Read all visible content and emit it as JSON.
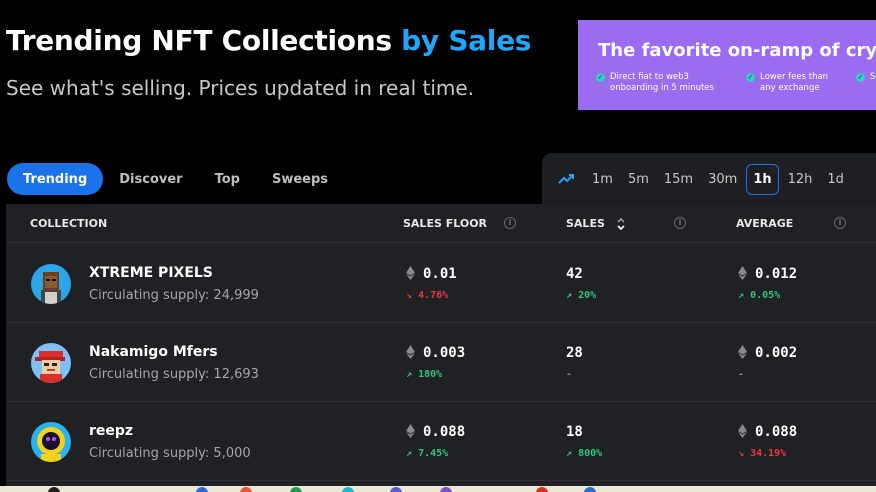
{
  "header": {
    "title": "Trending NFT Collections",
    "title_accent": "by Sales",
    "subtitle": "See what's selling. Prices updated in real time."
  },
  "ad": {
    "headline": "The favorite on-ramp of cryp",
    "features": [
      "Direct fiat to web3 onboarding in 5 minutes",
      "Lower fees than any exchange",
      "S"
    ]
  },
  "tabs": [
    {
      "label": "Trending",
      "active": true
    },
    {
      "label": "Discover"
    },
    {
      "label": "Top"
    },
    {
      "label": "Sweeps"
    }
  ],
  "timeframes": [
    "1m",
    "5m",
    "15m",
    "30m",
    "1h",
    "12h",
    "1d"
  ],
  "active_timeframe": "1h",
  "columns": {
    "collection": "COLLECTION",
    "sales_floor": "SALES FLOOR",
    "sales": "SALES",
    "average": "AVERAGE"
  },
  "rows": [
    {
      "name": "XTREME PIXELS",
      "supply": "Circulating supply: 24,999",
      "floor": "0.01",
      "floor_change": "4.76%",
      "floor_dir": "down",
      "sales": "42",
      "sales_change": "20%",
      "sales_dir": "up",
      "average": "0.012",
      "average_change": "0.05%",
      "average_dir": "up"
    },
    {
      "name": "Nakamigo Mfers",
      "supply": "Circulating supply: 12,693",
      "floor": "0.003",
      "floor_change": "180%",
      "floor_dir": "up",
      "sales": "28",
      "sales_change": "-",
      "sales_dir": "flat",
      "average": "0.002",
      "average_change": "-",
      "average_dir": "flat"
    },
    {
      "name": "reepz",
      "supply": "Circulating supply: 5,000",
      "floor": "0.088",
      "floor_change": "7.45%",
      "floor_dir": "up",
      "sales": "18",
      "sales_change": "800%",
      "sales_dir": "up",
      "average": "0.088",
      "average_change": "34.19%",
      "average_dir": "down"
    }
  ],
  "colors": {
    "accent": "#1ea7fd",
    "active_tab": "#1a73e8",
    "up": "#2bc67a",
    "down": "#f0383d",
    "ad_background": "#9b6cf0"
  }
}
